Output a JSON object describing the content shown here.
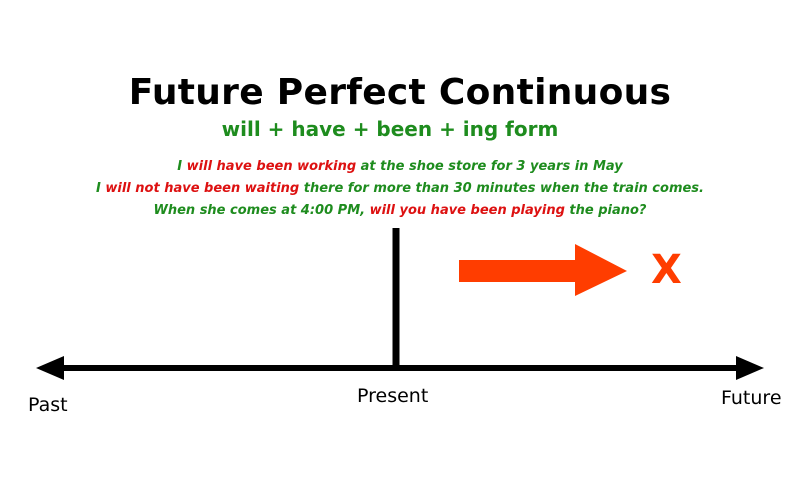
{
  "title": "Future Perfect Continuous",
  "formula": "will + have + been + ing form",
  "examples": [
    {
      "parts": [
        {
          "text": "I ",
          "color": "green"
        },
        {
          "text": "will have been working",
          "color": "red"
        },
        {
          "text": " at the shoe store for 3 years in May",
          "color": "green"
        }
      ]
    },
    {
      "parts": [
        {
          "text": "I ",
          "color": "green"
        },
        {
          "text": "will not have been waiting",
          "color": "red"
        },
        {
          "text": " there for more than 30 minutes when the train comes.",
          "color": "green"
        }
      ]
    },
    {
      "parts": [
        {
          "text": "When she comes at 4:00 PM, ",
          "color": "green"
        },
        {
          "text": "will you have been playing",
          "color": "red"
        },
        {
          "text": " the piano?",
          "color": "green"
        }
      ]
    }
  ],
  "timeline": {
    "past_label": "Past",
    "present_label": "Present",
    "future_label": "Future",
    "marker": "X"
  },
  "colors": {
    "green": "#1e8c1e",
    "red": "#dd1111",
    "arrow": "#ff3d00",
    "line": "#000000"
  }
}
